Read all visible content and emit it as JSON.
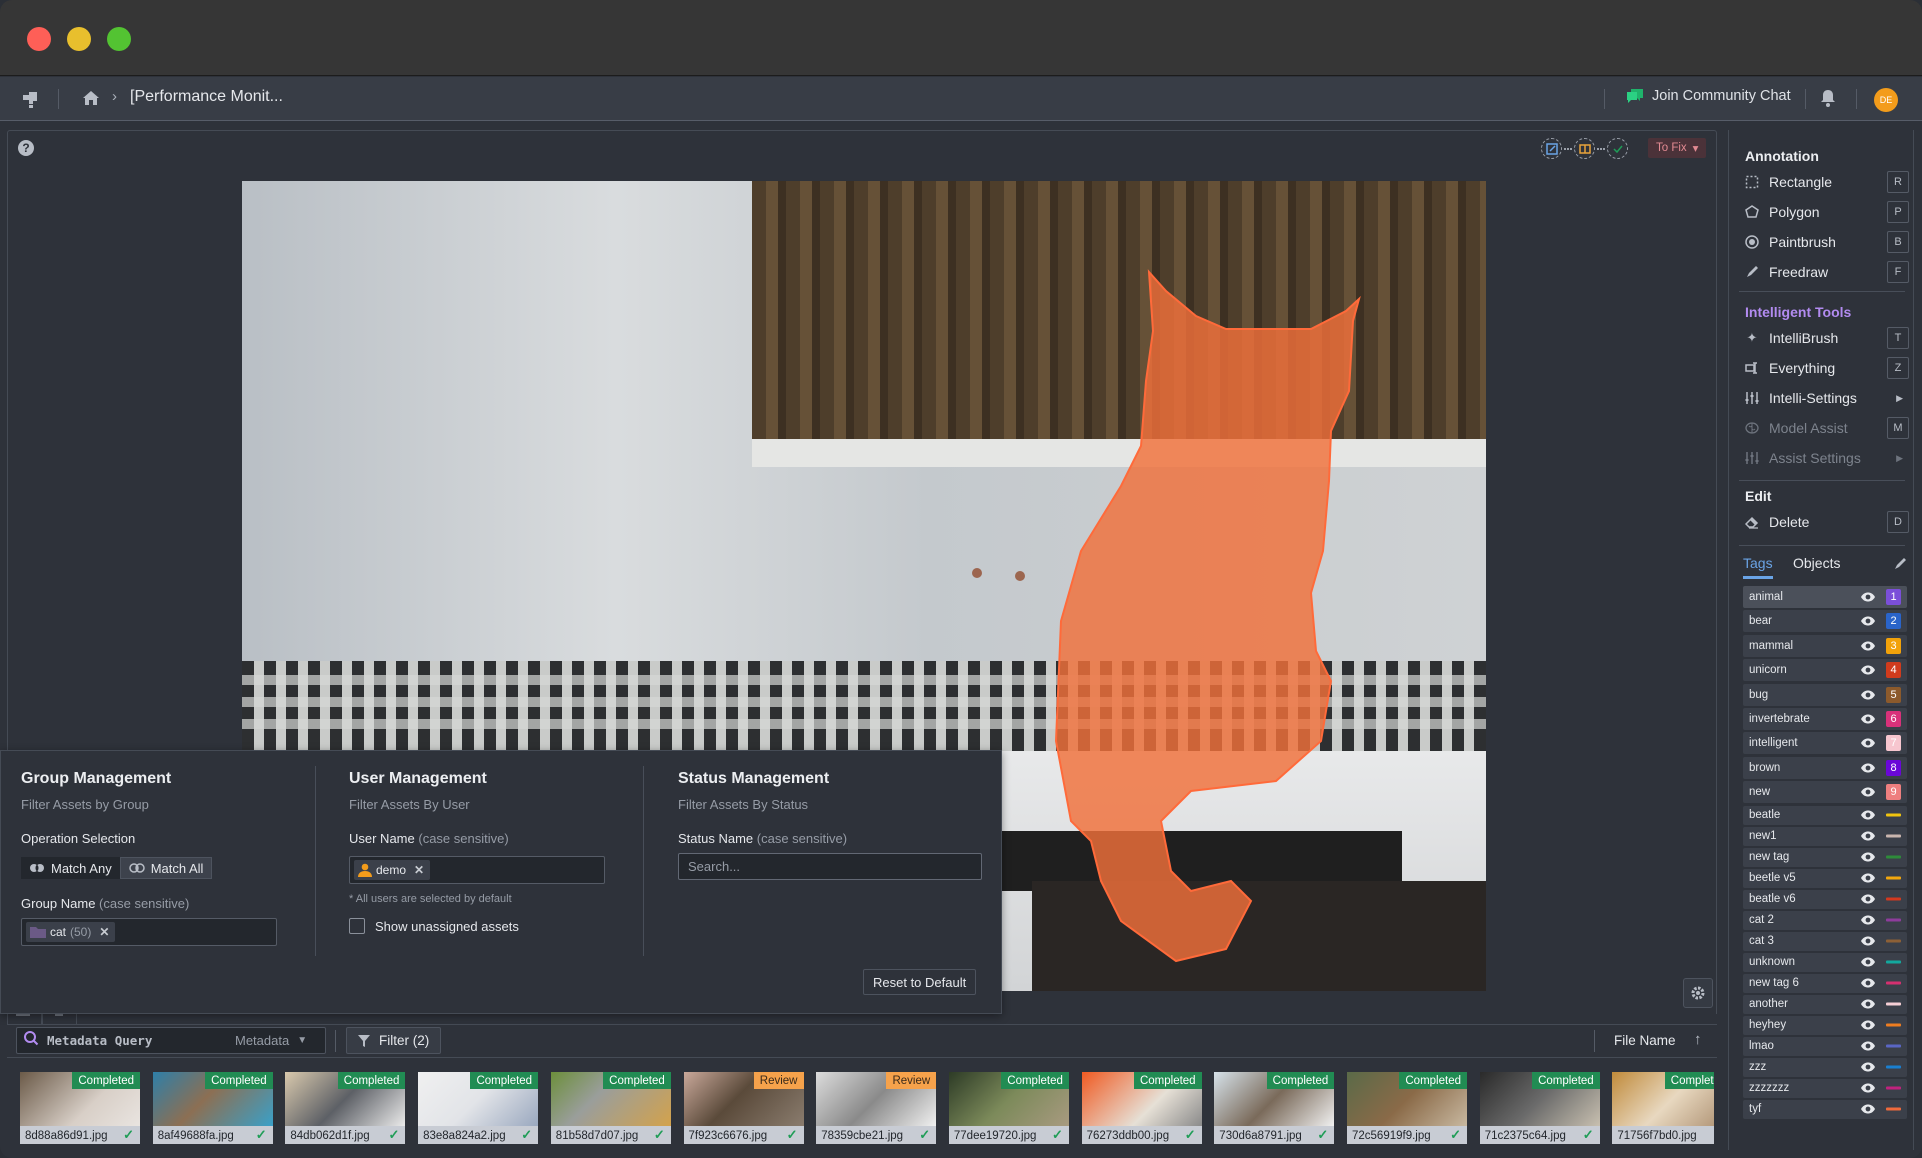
{
  "window": {
    "controls": [
      "close",
      "minimize",
      "maximize"
    ]
  },
  "nav": {
    "breadcrumb_title": "[Performance Monit...",
    "community_chat": "Join Community Chat",
    "avatar_initials": "DE",
    "avatar_color": "#f39c1b"
  },
  "canvas": {
    "workflow_steps": [
      "label",
      "review",
      "complete"
    ],
    "status_dropdown": "To Fix",
    "help": "?"
  },
  "annotation": {
    "title": "Annotation",
    "tools": [
      {
        "label": "Rectangle",
        "key": "R",
        "icon": "rectangle-icon"
      },
      {
        "label": "Polygon",
        "key": "P",
        "icon": "polygon-icon"
      },
      {
        "label": "Paintbrush",
        "key": "B",
        "icon": "paintbrush-icon"
      },
      {
        "label": "Freedraw",
        "key": "F",
        "icon": "pencil-icon"
      }
    ]
  },
  "intelligent": {
    "title": "Intelligent Tools",
    "tools": [
      {
        "label": "IntelliBrush",
        "key": "T",
        "icon": "sparkle-icon"
      },
      {
        "label": "Everything",
        "key": "Z",
        "icon": "everything-icon"
      },
      {
        "label": "Intelli-Settings",
        "key": "",
        "icon": "sliders-icon",
        "submenu": true
      },
      {
        "label": "Model Assist",
        "key": "M",
        "icon": "brain-icon",
        "disabled": true
      },
      {
        "label": "Assist Settings",
        "key": "",
        "icon": "sliders-icon",
        "submenu": true,
        "disabled": true
      }
    ]
  },
  "edit": {
    "title": "Edit",
    "tools": [
      {
        "label": "Delete",
        "key": "D",
        "icon": "eraser-icon"
      }
    ]
  },
  "tabs": {
    "tags": "Tags",
    "objects": "Objects",
    "active": "Tags"
  },
  "tags": [
    {
      "name": "animal",
      "num": "1",
      "color": "#7b4fd9"
    },
    {
      "name": "bear",
      "num": "2",
      "color": "#2a64c9"
    },
    {
      "name": "mammal",
      "num": "3",
      "color": "#f2a20a"
    },
    {
      "name": "unicorn",
      "num": "4",
      "color": "#d03b1d"
    },
    {
      "name": "bug",
      "num": "5",
      "color": "#8c5a2c"
    },
    {
      "name": "invertebrate",
      "num": "6",
      "color": "#d8317a"
    },
    {
      "name": "intelligent",
      "num": "7",
      "color": "#f7c6cf"
    },
    {
      "name": "brown",
      "num": "8",
      "color": "#6a07d8"
    },
    {
      "name": "new",
      "num": "9",
      "color": "#ee7f7f"
    },
    {
      "name": "beatle",
      "num": "",
      "color": "#f1c40f"
    },
    {
      "name": "new1",
      "num": "",
      "color": "#c9b5ae"
    },
    {
      "name": "new tag",
      "num": "",
      "color": "#2e8b3a"
    },
    {
      "name": "beetle v5",
      "num": "",
      "color": "#f3a70d"
    },
    {
      "name": "beatle v6",
      "num": "",
      "color": "#d3391f"
    },
    {
      "name": "cat 2",
      "num": "",
      "color": "#8e3c9c"
    },
    {
      "name": "cat 3",
      "num": "",
      "color": "#8d6036"
    },
    {
      "name": "unknown",
      "num": "",
      "color": "#13a89e"
    },
    {
      "name": "new tag 6",
      "num": "",
      "color": "#d53070"
    },
    {
      "name": "another",
      "num": "",
      "color": "#f6cfd6"
    },
    {
      "name": "heyhey",
      "num": "",
      "color": "#ee7d20"
    },
    {
      "name": "lmao",
      "num": "",
      "color": "#5a66c4"
    },
    {
      "name": "zzz",
      "num": "",
      "color": "#1a7fd0"
    },
    {
      "name": "zzzzzzz",
      "num": "",
      "color": "#c0227e"
    },
    {
      "name": "tyf",
      "num": "",
      "color": "#ef6a3c"
    }
  ],
  "filters": {
    "group": {
      "title": "Group Management",
      "subtitle": "Filter Assets by Group",
      "operation_label": "Operation Selection",
      "match_any": "Match Any",
      "match_all": "Match All",
      "name_label": "Group Name",
      "case_note": "(case sensitive)",
      "chip_name": "cat",
      "chip_count": "(50)"
    },
    "user": {
      "title": "User Management",
      "subtitle": "Filter Assets By User",
      "name_label": "User Name",
      "case_note": "(case sensitive)",
      "chip_name": "demo",
      "note": "* All users are selected by default",
      "unassigned_label": "Show unassigned assets",
      "unassigned_checked": false
    },
    "status": {
      "title": "Status Management",
      "subtitle": "Filter Assets By Status",
      "name_label": "Status Name",
      "case_note": "(case sensitive)",
      "search_placeholder": "Search..."
    },
    "reset_label": "Reset to Default"
  },
  "toolbar": {
    "query_placeholder": "Metadata Query",
    "query_type": "Metadata",
    "filter_label": "Filter (2)",
    "sort_field": "File Name",
    "sort_dir": "ascending"
  },
  "assets": [
    {
      "file": "8d88a86d91.jpg",
      "status": "Completed"
    },
    {
      "file": "8af49688fa.jpg",
      "status": "Completed"
    },
    {
      "file": "84db062d1f.jpg",
      "status": "Completed"
    },
    {
      "file": "83e8a824a2.jpg",
      "status": "Completed"
    },
    {
      "file": "81b58d7d07.jpg",
      "status": "Completed"
    },
    {
      "file": "7f923c6676.jpg",
      "status": "Review"
    },
    {
      "file": "78359cbe21.jpg",
      "status": "Review"
    },
    {
      "file": "77dee19720.jpg",
      "status": "Completed"
    },
    {
      "file": "76273ddb00.jpg",
      "status": "Completed"
    },
    {
      "file": "730d6a8791.jpg",
      "status": "Completed"
    },
    {
      "file": "72c56919f9.jpg",
      "status": "Completed"
    },
    {
      "file": "71c2375c64.jpg",
      "status": "Completed"
    },
    {
      "file": "71756f7bd0.jpg",
      "status": "Completed"
    }
  ]
}
